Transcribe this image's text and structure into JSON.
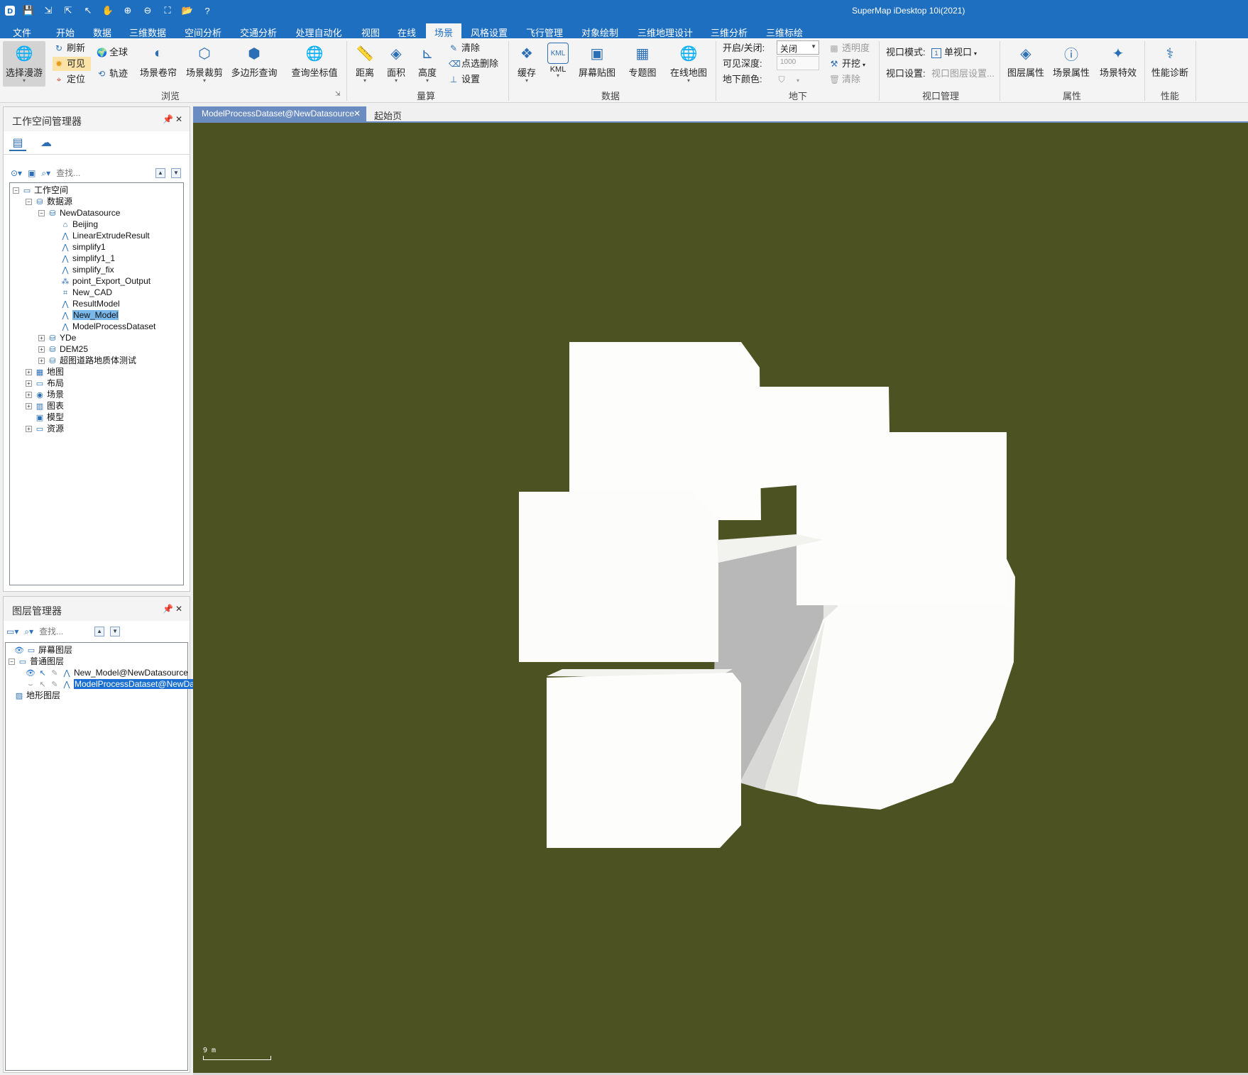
{
  "app": {
    "title": "SuperMap iDesktop 10i(2021)",
    "quick_access_icons": [
      "app-logo-icon",
      "save-icon",
      "import-icon",
      "export-icon",
      "select-pointer-icon",
      "pan-hand-icon",
      "zoom-in-icon",
      "zoom-out-icon",
      "full-extent-icon",
      "open-folder-icon",
      "help-icon"
    ]
  },
  "menu": {
    "tabs": [
      "文件",
      "开始",
      "数据",
      "三维数据",
      "空间分析",
      "交通分析",
      "处理自动化",
      "视图",
      "在线",
      "场景",
      "风格设置",
      "飞行管理",
      "对象绘制",
      "三维地理设计",
      "三维分析",
      "三维标绘"
    ],
    "active": "场景"
  },
  "ribbon": {
    "browse": {
      "label": "浏览",
      "select_roam": "选择漫游",
      "refresh": "刷新",
      "visible": "可见",
      "locate": "定位",
      "globe": "全球",
      "track": "轨迹",
      "scene_shutter": "场景卷帘",
      "scene_clip": "场景裁剪",
      "polygon_query": "多边形查询",
      "query_coord": "查询坐标值"
    },
    "measure": {
      "label": "量算",
      "distance": "距离",
      "area": "面积",
      "height": "高度",
      "clear": "清除",
      "pick_delete": "点选删除",
      "settings": "设置"
    },
    "data": {
      "label": "数据",
      "cache": "缓存",
      "kml": "KML",
      "screen_overlay": "屏幕贴图",
      "thematic": "专题图",
      "online_map": "在线地图"
    },
    "underground": {
      "label": "地下",
      "on_off_label": "开启/关闭:",
      "on_off_value": "关闭",
      "depth_label": "可见深度:",
      "depth_value": "1000",
      "color_label": "地下颜色:",
      "transparency": "透明度",
      "excavate": "开挖",
      "clear": "清除"
    },
    "viewport": {
      "label": "视口管理",
      "mode_label": "视口模式:",
      "mode_value": "单视口",
      "mode_index": "1",
      "settings_label": "视口设置:",
      "settings_value": "视口图层设置..."
    },
    "properties": {
      "label": "属性",
      "layer_props": "图层属性",
      "scene_props": "场景属性",
      "scene_effects": "场景特效"
    },
    "performance": {
      "label": "性能",
      "diagnose": "性能诊断"
    }
  },
  "workspace_panel": {
    "title": "工作空间管理器",
    "search_placeholder": "查找...",
    "tree": [
      {
        "label": "工作空间",
        "icon": "workspace-icon",
        "level": 0,
        "exp": "−"
      },
      {
        "label": "数据源",
        "icon": "datasources-icon",
        "level": 1,
        "exp": "−"
      },
      {
        "label": "NewDatasource",
        "icon": "datasource-icon",
        "level": 2,
        "exp": "−"
      },
      {
        "label": "Beijing",
        "icon": "region-dataset-icon",
        "level": 3
      },
      {
        "label": "LinearExtrudeResult",
        "icon": "model-dataset-icon",
        "level": 3
      },
      {
        "label": "simplify1",
        "icon": "model-dataset-icon",
        "level": 3
      },
      {
        "label": "simplify1_1",
        "icon": "model-dataset-icon",
        "level": 3
      },
      {
        "label": "simplify_fix",
        "icon": "model-dataset-icon",
        "level": 3
      },
      {
        "label": "point_Export_Output",
        "icon": "point-dataset-icon",
        "level": 3
      },
      {
        "label": "New_CAD",
        "icon": "cad-dataset-icon",
        "level": 3
      },
      {
        "label": "ResultModel",
        "icon": "model-dataset-icon",
        "level": 3
      },
      {
        "label": "New_Model",
        "icon": "model-dataset-icon",
        "level": 3,
        "selected": true
      },
      {
        "label": "ModelProcessDataset",
        "icon": "model-dataset-icon",
        "level": 3
      },
      {
        "label": "YDe",
        "icon": "datasource-icon",
        "level": 2,
        "exp": "+"
      },
      {
        "label": "DEM25",
        "icon": "datasource-icon",
        "level": 2,
        "exp": "+"
      },
      {
        "label": "超图道路地质体测试",
        "icon": "datasource-icon",
        "level": 2,
        "exp": "+"
      },
      {
        "label": "地图",
        "icon": "maps-icon",
        "level": 1,
        "exp": "+"
      },
      {
        "label": "布局",
        "icon": "layouts-icon",
        "level": 1,
        "exp": "+"
      },
      {
        "label": "场景",
        "icon": "scenes-icon",
        "level": 1,
        "exp": "+"
      },
      {
        "label": "图表",
        "icon": "charts-icon",
        "level": 1,
        "exp": "+"
      },
      {
        "label": "模型",
        "icon": "models-icon",
        "level": 1
      },
      {
        "label": "资源",
        "icon": "resources-icon",
        "level": 1,
        "exp": "+"
      }
    ]
  },
  "layer_panel": {
    "title": "图层管理器",
    "search_placeholder": "查找...",
    "tree": [
      {
        "label": "屏幕图层",
        "level": 0
      },
      {
        "label": "普通图层",
        "level": 0,
        "exp": "−"
      },
      {
        "label": "New_Model@NewDatasource",
        "level": 1
      },
      {
        "label": "ModelProcessDataset@NewDatasource",
        "level": 1,
        "selected": true
      },
      {
        "label": "地形图层",
        "level": 0
      }
    ]
  },
  "doc_tabs": {
    "active": "ModelProcessDataset@NewDatasource",
    "other": "起始页"
  },
  "scene": {
    "background": "#4d5222",
    "scale_label": "9 m"
  }
}
